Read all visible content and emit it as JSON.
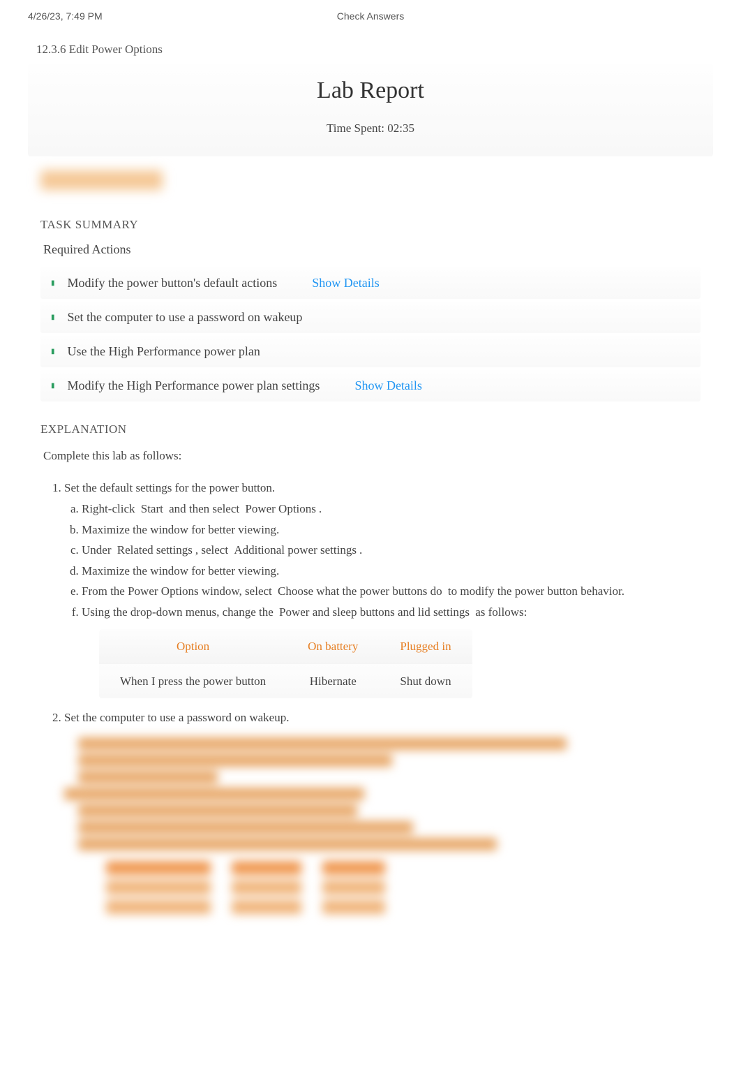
{
  "header": {
    "timestamp": "4/26/23, 7:49 PM",
    "page_title": "Check Answers"
  },
  "breadcrumb": "12.3.6 Edit Power Options",
  "report": {
    "title": "Lab Report",
    "time_spent_label": "Time Spent: 02:35"
  },
  "task_summary": {
    "heading": "TASK SUMMARY",
    "required_actions_label": "Required Actions",
    "actions": [
      {
        "text": "Modify the power button's default actions",
        "details": "Show Details"
      },
      {
        "text": "Set the computer to use a password on wakeup",
        "details": ""
      },
      {
        "text": "Use the High Performance power plan",
        "details": ""
      },
      {
        "text": "Modify the High Performance power plan settings",
        "details": "Show Details"
      }
    ]
  },
  "explanation": {
    "heading": "EXPLANATION",
    "intro": "Complete this lab as follows:",
    "step1": {
      "title": "Set the default settings for the power button.",
      "a_pre": "Right-click ",
      "a_b1": "Start",
      "a_mid": " and then select ",
      "a_b2": "Power Options",
      "a_post": ".",
      "b": "Maximize the window for better viewing.",
      "c_pre": "Under ",
      "c_b1": "Related settings",
      "c_mid": ", select ",
      "c_b2": "Additional power settings",
      "c_post": ".",
      "d": "Maximize the window for better viewing.",
      "e_pre": "From the Power Options window, select ",
      "e_b1": "Choose what the power buttons do",
      "e_post": " to modify the power button behavior.",
      "f_pre": "Using the drop-down menus, change the ",
      "f_b1": "Power and sleep buttons and lid settings",
      "f_post": " as follows:",
      "table": {
        "h1": "Option",
        "h2": "On battery",
        "h3": "Plugged in",
        "r1c1": "When I press the power button",
        "r1c2": "Hibernate",
        "r1c3": "Shut down"
      }
    },
    "step2": {
      "title": "Set the computer to use a password on wakeup."
    }
  }
}
